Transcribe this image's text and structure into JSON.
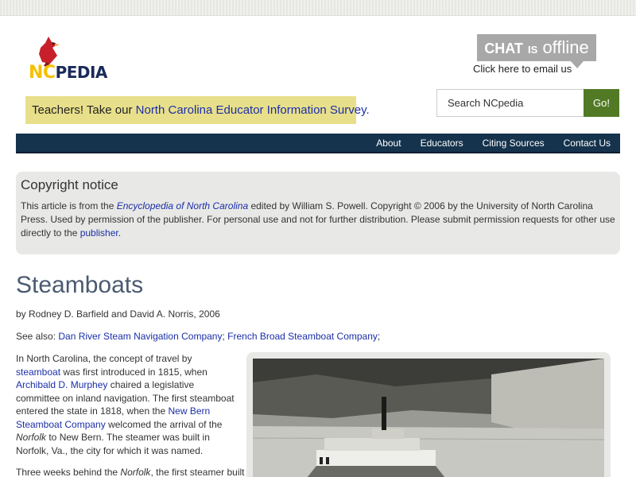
{
  "header": {
    "logo": {
      "nc": "NC",
      "pedia": "PEDIA"
    },
    "survey": {
      "prefix": "Teachers! Take our ",
      "link": "North Carolina Educator Information Survey."
    },
    "chat": {
      "chat": "CHAT",
      "is": "IS",
      "offline": "offline",
      "email_link": "Click here to email us"
    },
    "search": {
      "value": "Search NCpedia",
      "button": "Go!"
    }
  },
  "nav": {
    "items": [
      "About",
      "Educators",
      "Citing Sources",
      "Contact Us"
    ]
  },
  "copyright": {
    "title": "Copyright notice",
    "t1": "This article is from the ",
    "book": "Encyclopedia of North Carolina",
    "t2": " edited by William S. Powell. Copyright © 2006 by the University of North Carolina Press. Used by permission of the publisher. For personal use and not for further distribution. Please submit permission requests for other use directly to the ",
    "publisher": "publisher",
    "t3": "."
  },
  "article": {
    "title": "Steamboats",
    "byline": "by Rodney D. Barfield and David A. Norris, 2006",
    "see_also_label": "See also: ",
    "see_also": [
      "Dan River Steam Navigation Company",
      "French Broad Steamboat Company"
    ],
    "sep": "; ",
    "sep_end": ";",
    "p1": {
      "a": "In North Carolina, the concept of travel by ",
      "l1": "steamboat",
      "b": " was first introduced in 1815, when ",
      "l2": "Archibald D. Murphey",
      "c": " chaired a legislative committee on inland navigation. The first steamboat entered the state in 1818, when the ",
      "l3": "New Bern Steamboat Company",
      "d": " welcomed the arrival of the ",
      "e": "Norfolk",
      "f": " to New Bern. The steamer was built in Norfolk, Va., the city for which it was named."
    },
    "p2": {
      "a": "Three weeks behind the ",
      "b": "Norfolk",
      "c": ", the first steamer built"
    }
  },
  "colors": {
    "nav": "#15334d",
    "survey": "#e8df8a",
    "search_button": "#527a25",
    "link": "#1b2fa8"
  }
}
